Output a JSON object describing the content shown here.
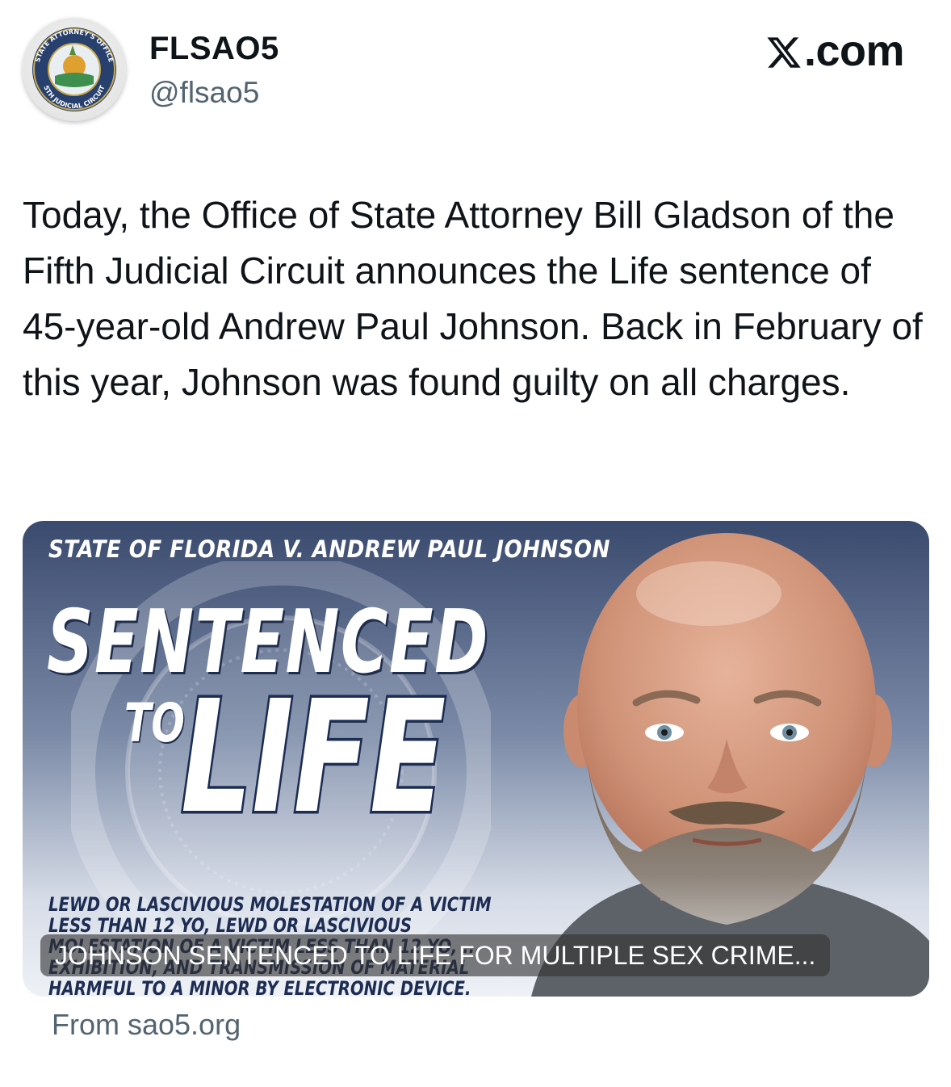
{
  "header": {
    "display_name": "FLSAO5",
    "handle": "@flsao5",
    "brand": ".com",
    "avatar": {
      "ring_text_top": "STATE ATTORNEY'S OFFICE",
      "ring_text_bottom": "5TH JUDICIAL CIRCUIT"
    }
  },
  "tweet": {
    "text": "Today, the Office of State Attorney Bill Gladson of the Fifth Judicial Circuit announces the Life sentence of 45-year-old Andrew Paul Johnson. Back in February of this year, Johnson was found guilty on all charges."
  },
  "card": {
    "case_title": "STATE OF FLORIDA V. ANDREW PAUL JOHNSON",
    "headline_1": "SENTENCED",
    "headline_2": "TO",
    "headline_3": "LIFE",
    "charges": "LEWD OR LASCIVIOUS MOLESTATION OF A VICTIM LESS THAN 12 YO, LEWD OR LASCIVIOUS MOLESTATION OF A VICTIM LESS THAN 12 YO, ... EXHIBITION, AND TRANSMISSION OF MATERIAL HARMFUL TO A MINOR BY ELECTRONIC DEVICE.",
    "caption": "JOHNSON SENTENCED TO LIFE FOR MULTIPLE SEX CRIME...",
    "source": "From sao5.org"
  },
  "colors": {
    "text_primary": "#0f1419",
    "text_secondary": "#536471",
    "card_navy": "#1c2c52"
  },
  "icons": [
    "x-logo-icon",
    "seal-icon",
    "mugshot-image"
  ]
}
